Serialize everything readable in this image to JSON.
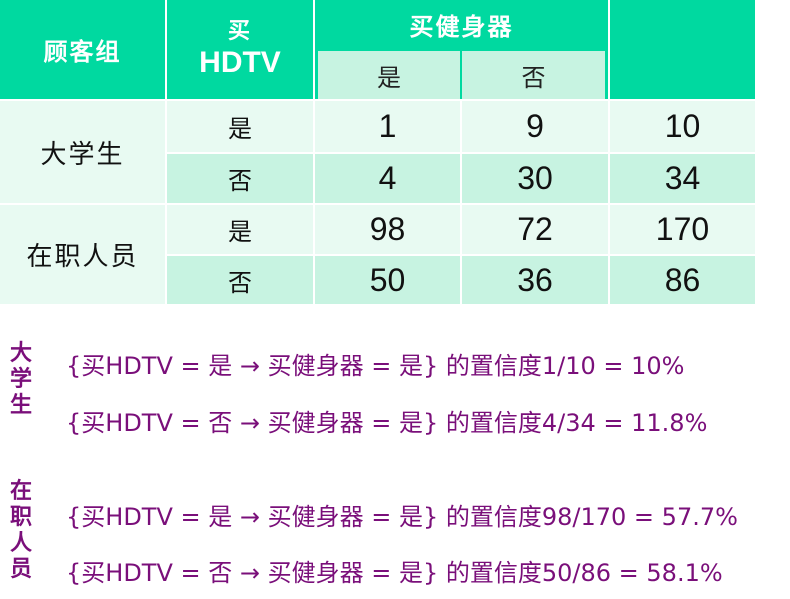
{
  "table": {
    "header": {
      "group": "顾客组",
      "hdtv_line1": "买",
      "hdtv_line2": "HDTV",
      "gym": "买健身器",
      "yes": "是",
      "no": "否"
    },
    "groups": [
      {
        "label": "大学生",
        "rows": [
          {
            "hdtv": "是",
            "yes": "1",
            "no": "9",
            "total": "10"
          },
          {
            "hdtv": "否",
            "yes": "4",
            "no": "30",
            "total": "34"
          }
        ]
      },
      {
        "label": "在职人员",
        "rows": [
          {
            "hdtv": "是",
            "yes": "98",
            "no": "72",
            "total": "170"
          },
          {
            "hdtv": "否",
            "yes": "50",
            "no": "36",
            "total": "86"
          }
        ]
      }
    ]
  },
  "rules": {
    "students_label": [
      "大",
      "学",
      "生"
    ],
    "workers_label": [
      "在",
      "职",
      "人",
      "员"
    ],
    "lines": [
      "{买HDTV = 是 → 买健身器 = 是} 的置信度1/10 = 10%",
      "{买HDTV = 否 → 买健身器 = 是} 的置信度4/34 = 11.8%",
      "{买HDTV = 是 → 买健身器 = 是} 的置信度98/170 = 57.7%",
      "{买HDTV = 否 → 买健身器 = 是} 的置信度50/86 = 58.1%"
    ]
  },
  "colors": {
    "header": "#00d9a0",
    "light": "#e8faf2",
    "mid": "#c7f3e1",
    "rule_text": "#7a0f7a"
  }
}
